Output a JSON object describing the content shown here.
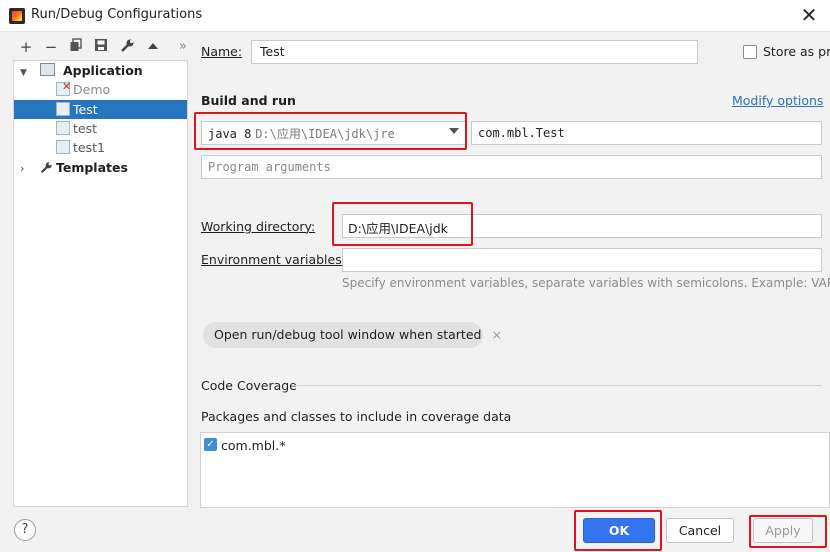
{
  "window": {
    "title": "Run/Debug Configurations"
  },
  "toolbar": {
    "icons": [
      "add-icon",
      "remove-icon",
      "copy-icon",
      "save-icon",
      "wrench-icon",
      "move-up-icon",
      "more-icon"
    ]
  },
  "tree": {
    "application": "Application",
    "items": [
      "Demo",
      "Test",
      "test",
      "test1"
    ],
    "templates": "Templates"
  },
  "form": {
    "name_label": "Name:",
    "name_value": "Test",
    "store_label": "Store as pr",
    "section_build": "Build and run",
    "modify_options": "Modify options",
    "jre_version": "java 8",
    "jre_path": "D:\\应用\\IDEA\\jdk\\jre",
    "main_class": "com.mbl.Test",
    "program_args_placeholder": "Program arguments",
    "working_dir_label": "Working directory:",
    "working_dir_value": "D:\\应用\\IDEA\\jdk",
    "env_label": "Environment variables:",
    "env_hint": "Specify environment variables, separate variables with semicolons. Example: VAR=valu",
    "chip_label": "Open run/debug tool window when started",
    "chip_close": "×",
    "coverage_title": "Code Coverage",
    "packages_label": "Packages and classes to include in coverage data",
    "coverage_item": "com.mbl.*"
  },
  "buttons": {
    "help": "?",
    "ok": "OK",
    "cancel": "Cancel",
    "apply": "Apply"
  },
  "colors": {
    "accent": "#2675bf",
    "highlight": "#e0141e",
    "link": "#2f6fc1"
  }
}
